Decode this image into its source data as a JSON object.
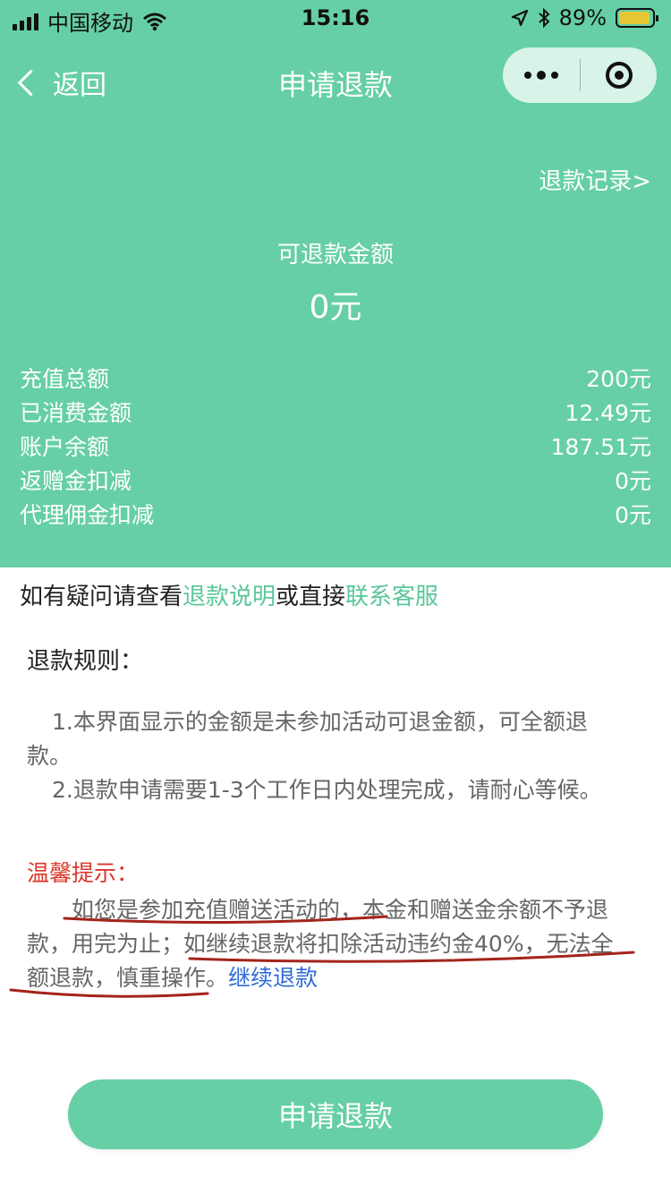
{
  "status_bar": {
    "carrier": "中国移动",
    "time": "15:16",
    "battery_percent": "89%"
  },
  "nav": {
    "back_label": "返回",
    "title": "申请退款"
  },
  "refund": {
    "record_link": "退款记录>",
    "refundable_label": "可退款金额",
    "refundable_value": "0元"
  },
  "details": [
    {
      "label": "充值总额",
      "value": "200元"
    },
    {
      "label": "已消费金额",
      "value": "12.49元"
    },
    {
      "label": "账户余额",
      "value": "187.51元"
    },
    {
      "label": "返赠金扣减",
      "value": "0元"
    },
    {
      "label": "代理佣金扣减",
      "value": "0元"
    }
  ],
  "help": {
    "prefix": "如有疑问请查看",
    "link1": "退款说明",
    "middle": "或直接",
    "link2": "联系客服"
  },
  "rules": {
    "title": "退款规则：",
    "items": [
      "1.本界面显示的金额是未参加活动可退金额，可全额退款。",
      "2.退款申请需要1-3个工作日内处理完成，请耐心等候。"
    ]
  },
  "tip": {
    "title": "温馨提示：",
    "text": "如您是参加充值赠送活动的，本金和赠送金余额不予退款，用完为止；如继续退款将扣除活动违约金40%，无法全额退款，慎重操作。",
    "link": "继续退款"
  },
  "submit_label": "申请退款",
  "colors": {
    "accent": "#66cfa5",
    "link_green": "#5ac79a",
    "warning_red": "#d9372b",
    "link_blue": "#2f6bd6",
    "annotation": "#a3241c"
  },
  "icons": [
    "signal-icon",
    "wifi-icon",
    "location-icon",
    "bluetooth-icon",
    "battery-icon",
    "back-chevron-icon",
    "more-icon",
    "close-target-icon"
  ]
}
